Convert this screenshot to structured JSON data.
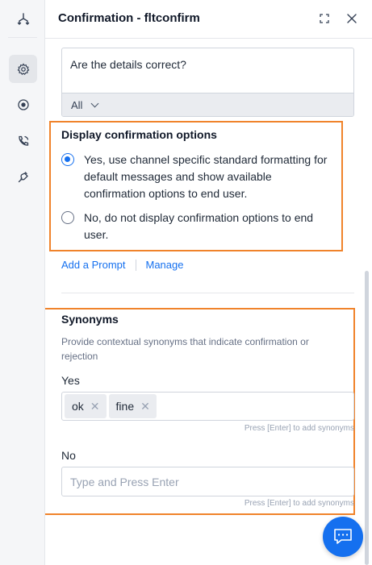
{
  "header": {
    "title": "Confirmation - fltconfirm",
    "expand_icon": "expand-icon",
    "close_icon": "close-icon"
  },
  "rail": {
    "items": [
      "flow-icon",
      "settings-icon",
      "target-icon",
      "voice-call-icon",
      "plug-icon"
    ],
    "active": "settings-icon"
  },
  "prompt": {
    "text": "Are the details correct?",
    "channel": "All"
  },
  "display_options": {
    "title": "Display confirmation options",
    "options": [
      {
        "label": "Yes, use channel specific standard formatting for default messages and show available confirmation options to end user.",
        "checked": true
      },
      {
        "label": "No, do not display confirmation options to end user.",
        "checked": false
      }
    ]
  },
  "links": {
    "add_prompt": "Add a Prompt",
    "manage": "Manage"
  },
  "synonyms": {
    "title": "Synonyms",
    "description": "Provide contextual synonyms that indicate confirmation or rejection",
    "yes": {
      "label": "Yes",
      "tags": [
        "ok",
        "fine"
      ],
      "remove": "✕",
      "hint": "Press [Enter] to add synonyms"
    },
    "no": {
      "label": "No",
      "placeholder": "Type and Press Enter",
      "hint": "Press [Enter] to add synonyms"
    }
  },
  "colors": {
    "accent": "#1570ef",
    "highlight": "#f0832b"
  }
}
